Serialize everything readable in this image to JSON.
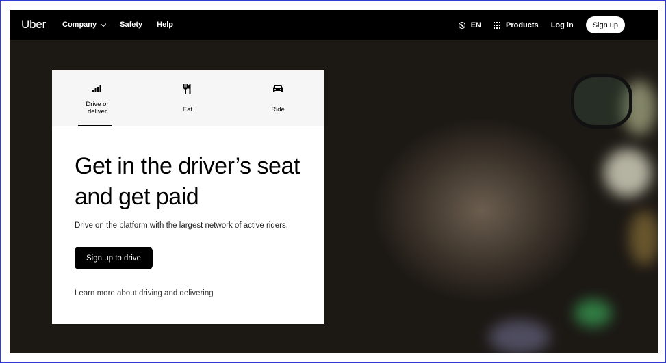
{
  "nav": {
    "logo": "Uber",
    "links": [
      {
        "label": "Company",
        "has_dropdown": true
      },
      {
        "label": "Safety"
      },
      {
        "label": "Help"
      }
    ],
    "language": "EN",
    "products_label": "Products",
    "login_label": "Log in",
    "signup_label": "Sign up",
    "icons": [
      "globe-icon",
      "grid-icon",
      "chevron-down-icon"
    ]
  },
  "card": {
    "tabs": [
      {
        "label": "Drive or deliver",
        "icon": "signal-bars-icon",
        "active": true
      },
      {
        "label": "Eat",
        "icon": "fork-knife-icon",
        "active": false
      },
      {
        "label": "Ride",
        "icon": "car-icon",
        "active": false
      }
    ],
    "headline": "Get in the driver’s seat and get paid",
    "subtext": "Drive on the platform with the largest network of active riders.",
    "cta_label": "Sign up to drive",
    "learn_more": "Learn more about driving and delivering"
  },
  "colors": {
    "nav_bg": "#000000",
    "card_bg": "#ffffff",
    "tabs_bg": "#f6f6f6",
    "cta_bg": "#000000",
    "frame_border": "#2f3fd6"
  }
}
